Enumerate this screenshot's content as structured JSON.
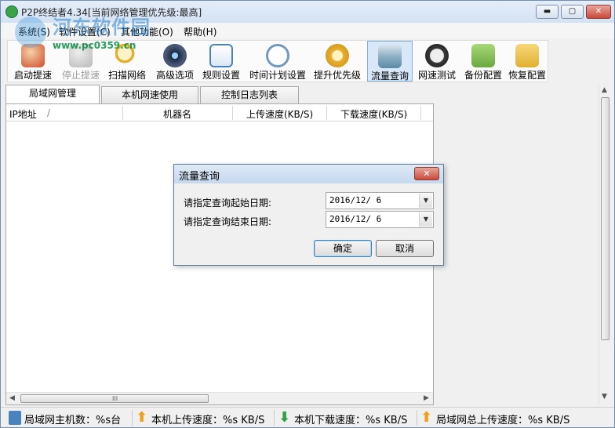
{
  "window": {
    "title": "P2P终结者4.34[当前网络管理优先级:最高]",
    "controls": {
      "minimize": "▬",
      "maximize": "▢",
      "close": "✕"
    }
  },
  "watermark": {
    "text": "河东软件园",
    "url": "www.pc0359.cn"
  },
  "menu": [
    {
      "label": "系统(S)"
    },
    {
      "label": "软件设置(C)"
    },
    {
      "label": "其他功能(O)"
    },
    {
      "label": "帮助(H)"
    }
  ],
  "toolbar": [
    {
      "label": "启动提速",
      "icon": "rocket-icon",
      "color": "#d04a2a",
      "enabled": true
    },
    {
      "label": "停止提速",
      "icon": "stop-rocket-icon",
      "color": "#b8b8b8",
      "enabled": false
    },
    {
      "label": "扫描网络",
      "icon": "magnifier-icon",
      "color": "#e0b030",
      "enabled": true
    },
    {
      "label": "高级选项",
      "icon": "camera-lens-icon",
      "color": "#4a5a78",
      "enabled": true
    },
    {
      "label": "规则设置",
      "icon": "document-rules-icon",
      "color": "#4a82c0",
      "enabled": true
    },
    {
      "label": "时间计划设置",
      "icon": "clock-icon",
      "color": "#7aa0c8",
      "enabled": true
    },
    {
      "label": "提升优先级",
      "icon": "award-ribbon-icon",
      "color": "#e8b030",
      "enabled": true
    },
    {
      "label": "流量查询",
      "icon": "database-globe-icon",
      "color": "#5a8aa8",
      "enabled": true,
      "active": true
    },
    {
      "label": "网速测试",
      "icon": "speedometer-icon",
      "color": "#3a3a3a",
      "enabled": true
    },
    {
      "label": "备份配置",
      "icon": "box-download-icon",
      "color": "#6aa840",
      "enabled": true
    },
    {
      "label": "恢复配置",
      "icon": "box-upload-icon",
      "color": "#e0b030",
      "enabled": true
    }
  ],
  "tabs": [
    {
      "label": "局域网管理",
      "selected": true
    },
    {
      "label": "本机网速使用",
      "selected": false
    },
    {
      "label": "控制日志列表",
      "selected": false
    }
  ],
  "table": {
    "columns": [
      "IP地址",
      "/",
      "机器名",
      "上传速度(KB/S)",
      "下载速度(KB/S)"
    ],
    "rows": []
  },
  "scroll": {
    "grip": "III",
    "left_arrow": "◀",
    "right_arrow": "▶",
    "up_arrow": "▲",
    "down_arrow": "▼"
  },
  "status": [
    {
      "text": "局域网主机数：%s台",
      "icon": "hosts-icon",
      "color": "#4a82c0"
    },
    {
      "text": "本机上传速度：%s KB/S",
      "icon": "upload-arrow-icon",
      "color": "#f0a020"
    },
    {
      "text": "本机下载速度：%s KB/S",
      "icon": "download-arrow-icon",
      "color": "#30a040"
    },
    {
      "text": "局域网总上传速度：%s KB/S",
      "icon": "upload-arrow-icon",
      "color": "#f0a020"
    }
  ],
  "dialog": {
    "title": "流量查询",
    "close_label": "✕",
    "start_label": "请指定查询起始日期:",
    "start_value": "2016/12/ 6",
    "end_label": "请指定查询结束日期:",
    "end_value": "2016/12/ 6",
    "dropdown_glyph": "▼",
    "ok_label": "确定",
    "cancel_label": "取消"
  }
}
